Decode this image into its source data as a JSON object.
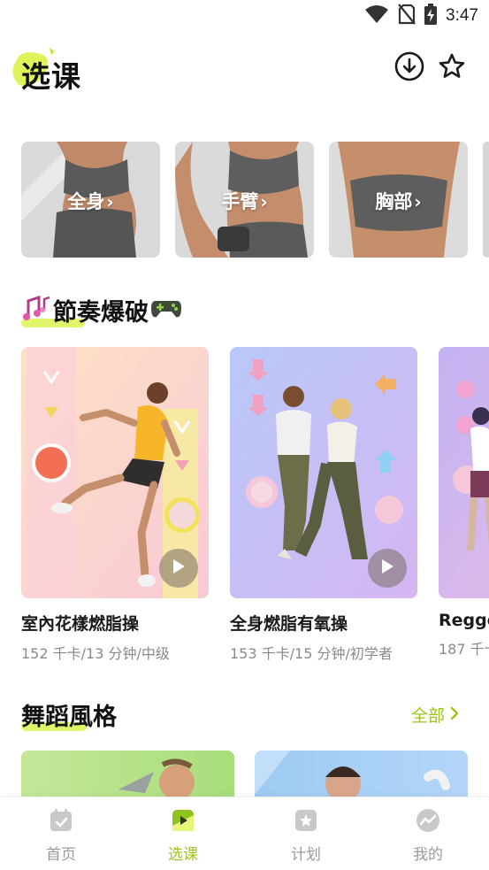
{
  "status_bar": {
    "time": "3:47",
    "icons": [
      "wifi-icon",
      "no-sim-icon",
      "battery-charging-icon"
    ]
  },
  "header": {
    "title": "选课",
    "actions": [
      "download-icon",
      "star-icon"
    ]
  },
  "body_parts": [
    {
      "label": "全身",
      "chevron": "›"
    },
    {
      "label": "手臂",
      "chevron": "›"
    },
    {
      "label": "胸部",
      "chevron": "›"
    }
  ],
  "rhythm_section": {
    "title": "節奏爆破",
    "title_icons": [
      "music-notes-icon",
      "gamepad-icon"
    ]
  },
  "workouts": [
    {
      "title": "室內花樣燃脂操",
      "meta": "152 千卡/13 分钟/中级"
    },
    {
      "title": "全身燃脂有氧操",
      "meta": "153 千卡/15 分钟/初学者"
    },
    {
      "title": "Regge",
      "meta": "187 千卡"
    }
  ],
  "dance_section": {
    "title": "舞蹈風格",
    "see_all": "全部",
    "see_all_icon": "chevron-right-icon"
  },
  "bottom_nav": [
    {
      "label": "首页",
      "icon": "calendar-check-icon",
      "active": false
    },
    {
      "label": "选课",
      "icon": "play-square-icon",
      "active": true
    },
    {
      "label": "计划",
      "icon": "star-badge-icon",
      "active": false
    },
    {
      "label": "我的",
      "icon": "trend-chart-icon",
      "active": false
    }
  ],
  "colors": {
    "accent": "#9cc51b",
    "highlight": "#dff45a",
    "inactive": "#9a9a9a"
  }
}
